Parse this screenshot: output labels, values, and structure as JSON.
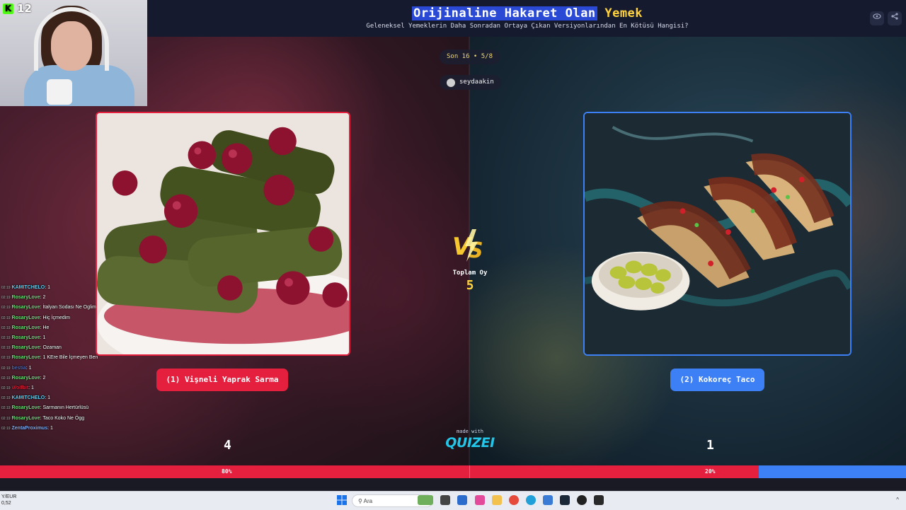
{
  "header": {
    "title_highlight": "Orijinaline Hakaret Olan",
    "title_accent": "Yemek",
    "subtitle": "Geleneksel Yemeklerin Daha Sonradan Ortaya Çıkan Versiyonlarından En Kötüsü Hangisi?",
    "icons": [
      "eye-icon",
      "share-icon"
    ]
  },
  "stream": {
    "platform_icon": "kick-logo",
    "viewer_count": "12"
  },
  "round": {
    "label": "Son 16 • 5/8",
    "username": "seydaakin"
  },
  "left_option": {
    "label": "(1) Vişneli Yaprak Sarma",
    "votes": "4",
    "percent": "80%",
    "percent_value": 80,
    "color": "#e5203f"
  },
  "right_option": {
    "label": "(2) Kokoreç Taco",
    "votes": "1",
    "percent": "20%",
    "percent_value": 20,
    "color": "#3d80f5"
  },
  "center": {
    "total_label": "Toplam Oy",
    "total_value": "5",
    "made_with": "made with",
    "brand": "QUIZEI"
  },
  "chat": [
    {
      "user": "KAMITCHELO",
      "msg": ": 1",
      "color": "#59d3f5"
    },
    {
      "user": "RosaryLove",
      "msg": ": 2",
      "color": "#6ee07a"
    },
    {
      "user": "RosaryLove",
      "msg": ": İtalyan Sodası Ne Oglim",
      "color": "#6ee07a"
    },
    {
      "user": "RosaryLove",
      "msg": ": Hiç İçmedim",
      "color": "#6ee07a"
    },
    {
      "user": "RosaryLove",
      "msg": ": He",
      "color": "#6ee07a"
    },
    {
      "user": "RosaryLove",
      "msg": ": 1",
      "color": "#6ee07a"
    },
    {
      "user": "RosaryLove",
      "msg": ": Ozaman",
      "color": "#6ee07a"
    },
    {
      "user": "RosaryLove",
      "msg": ": 1 KEre Bile İçmeyen Ben",
      "color": "#6ee07a"
    },
    {
      "user": "bestia",
      "msg": ": 1",
      "color": "#3a6bd6"
    },
    {
      "user": "RosaryLove",
      "msg": ": 2",
      "color": "#6ee07a"
    },
    {
      "user": "Wolfbit",
      "msg": ": 1",
      "color": "#d4213a"
    },
    {
      "user": "KAMITCHELO",
      "msg": ": 1",
      "color": "#59d3f5"
    },
    {
      "user": "RosaryLove",
      "msg": ": Sarmanın Hertürlüsü",
      "color": "#6ee07a"
    },
    {
      "user": "RosaryLove",
      "msg": ": Taco Koko Ne Ögg",
      "color": "#6ee07a"
    },
    {
      "user": "ZentaProximus",
      "msg": ": 1",
      "color": "#7fb0ff"
    }
  ],
  "chat_time": "02:19",
  "taskbar": {
    "left_line1": "Y/EUR",
    "left_line2": "0,52",
    "search_placeholder": "Ara",
    "tray": "^"
  }
}
